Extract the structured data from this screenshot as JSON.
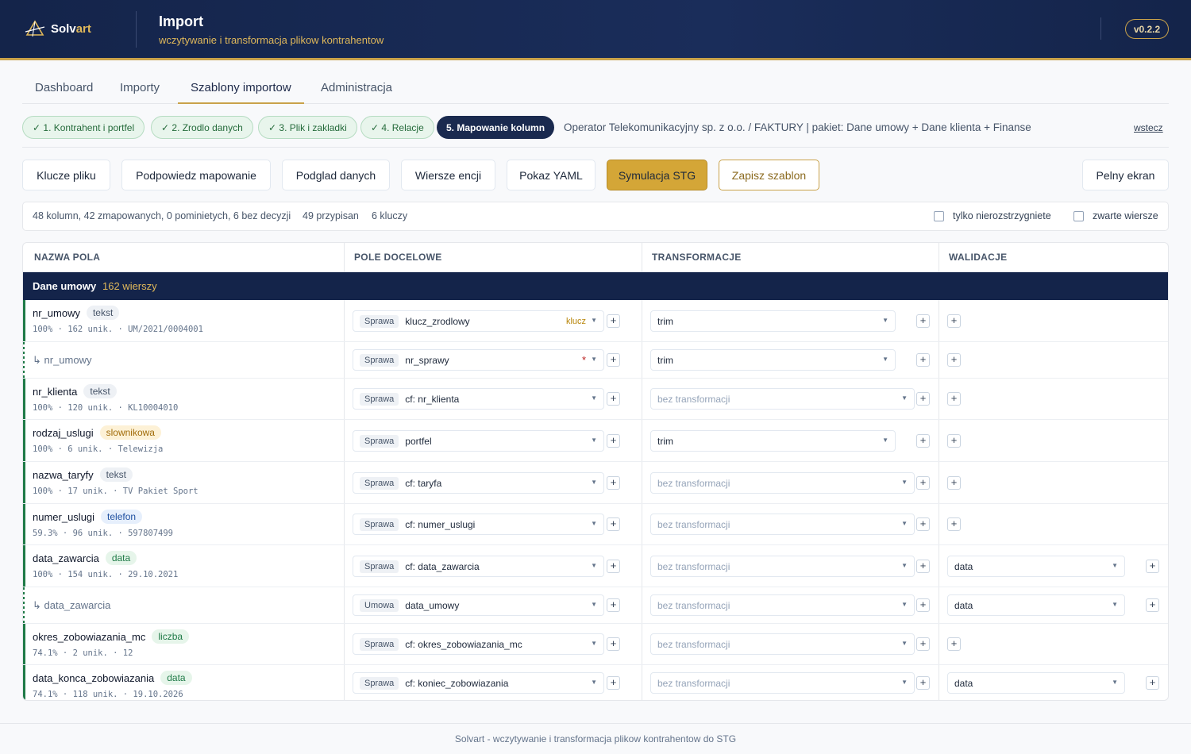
{
  "header": {
    "logo_text": "Solv",
    "logo_accent": "art",
    "title": "Import",
    "subtitle": "wczytywanie i transformacja plikow kontrahentow",
    "version": "v0.2.2"
  },
  "tabs": [
    {
      "label": "Dashboard"
    },
    {
      "label": "Importy"
    },
    {
      "label": "Szablony importow",
      "active": true
    },
    {
      "label": "Administracja"
    }
  ],
  "steps": [
    {
      "label": "✓ 1. Kontrahent i portfel"
    },
    {
      "label": "✓ 2. Zrodlo danych"
    },
    {
      "label": "✓ 3. Plik i zakladki"
    },
    {
      "label": "✓ 4. Relacje"
    },
    {
      "label": "5. Mapowanie kolumn",
      "active": true
    }
  ],
  "context_info": "Operator Telekomunikacyjny sp. z o.o. / FAKTURY | pakiet: Dane umowy + Dane klienta + Finanse",
  "back_label": "wstecz",
  "toolbar": {
    "keys": "Klucze pliku",
    "suggest": "Podpowiedz mapowanie",
    "preview": "Podglad danych",
    "entity_rows": "Wiersze encji",
    "yaml": "Pokaz YAML",
    "simulate": "Symulacja STG",
    "save": "Zapisz szablon",
    "fullscreen": "Pelny ekran"
  },
  "stats": {
    "columns": "48 kolumn, 42 zmapowanych, 0 pominietych, 6 bez decyzji",
    "assigned": "49 przypisan",
    "keys": "6 kluczy",
    "filter_unresolved": "tylko nierozstrzygniete",
    "compact_rows": "zwarte wiersze"
  },
  "table": {
    "headers": [
      "NAZWA POLA",
      "POLE DOCELOWE",
      "TRANSFORMACJE",
      "WALIDACJE"
    ],
    "group": {
      "title": "Dane umowy",
      "count": "162 wierszy"
    },
    "rows": [
      {
        "name": "nr_umowy",
        "badge": "tekst",
        "meta": "100% · 162 unik. · UM/2021/0004001",
        "entity": "Sprawa",
        "target": "klucz_zrodlowy",
        "key_tag": "klucz",
        "transform": "trim"
      },
      {
        "name": "↳ nr_umowy",
        "sub": true,
        "entity": "Sprawa",
        "target": "nr_sprawy",
        "required": "*",
        "transform": "trim"
      },
      {
        "name": "nr_klienta",
        "badge": "tekst",
        "meta": "100% · 120 unik. · KL10004010",
        "entity": "Sprawa",
        "target": "cf: nr_klienta",
        "transform": "bez transformacji"
      },
      {
        "name": "rodzaj_uslugi",
        "badge": "slownikowa",
        "meta": "100% · 6 unik. · Telewizja",
        "entity": "Sprawa",
        "target": "portfel",
        "transform": "trim"
      },
      {
        "name": "nazwa_taryfy",
        "badge": "tekst",
        "meta": "100% · 17 unik. · TV Pakiet Sport",
        "entity": "Sprawa",
        "target": "cf: taryfa",
        "transform": "bez transformacji"
      },
      {
        "name": "numer_uslugi",
        "badge": "telefon",
        "meta": "59.3% · 96 unik. · 597807499",
        "entity": "Sprawa",
        "target": "cf: numer_uslugi",
        "transform": "bez transformacji"
      },
      {
        "name": "data_zawarcia",
        "badge": "data",
        "meta": "100% · 154 unik. · 29.10.2021",
        "entity": "Sprawa",
        "target": "cf: data_zawarcia",
        "transform": "bez transformacji",
        "validation": "data"
      },
      {
        "name": "↳ data_zawarcia",
        "sub": true,
        "entity": "Umowa",
        "target": "data_umowy",
        "transform": "bez transformacji",
        "validation": "data"
      },
      {
        "name": "okres_zobowiazania_mc",
        "badge": "liczba",
        "meta": "74.1% · 2 unik. · 12",
        "entity": "Sprawa",
        "target": "cf: okres_zobowiazania_mc",
        "transform": "bez transformacji"
      },
      {
        "name": "data_konca_zobowiazania",
        "badge": "data",
        "meta": "74.1% · 118 unik. · 19.10.2026",
        "entity": "Sprawa",
        "target": "cf: koniec_zobowiazania",
        "transform": "bez transformacji",
        "validation": "data"
      }
    ]
  },
  "footer": "Solvart - wczytywanie i transformacja plikow kontrahentow do STG",
  "icons": {
    "logo": "solvart-logo-icon",
    "caret": "chevron-down-icon",
    "plus": "plus-icon"
  },
  "colors": {
    "navy": "#14244a",
    "gold": "#c9a24a",
    "green": "#1f7a47"
  }
}
